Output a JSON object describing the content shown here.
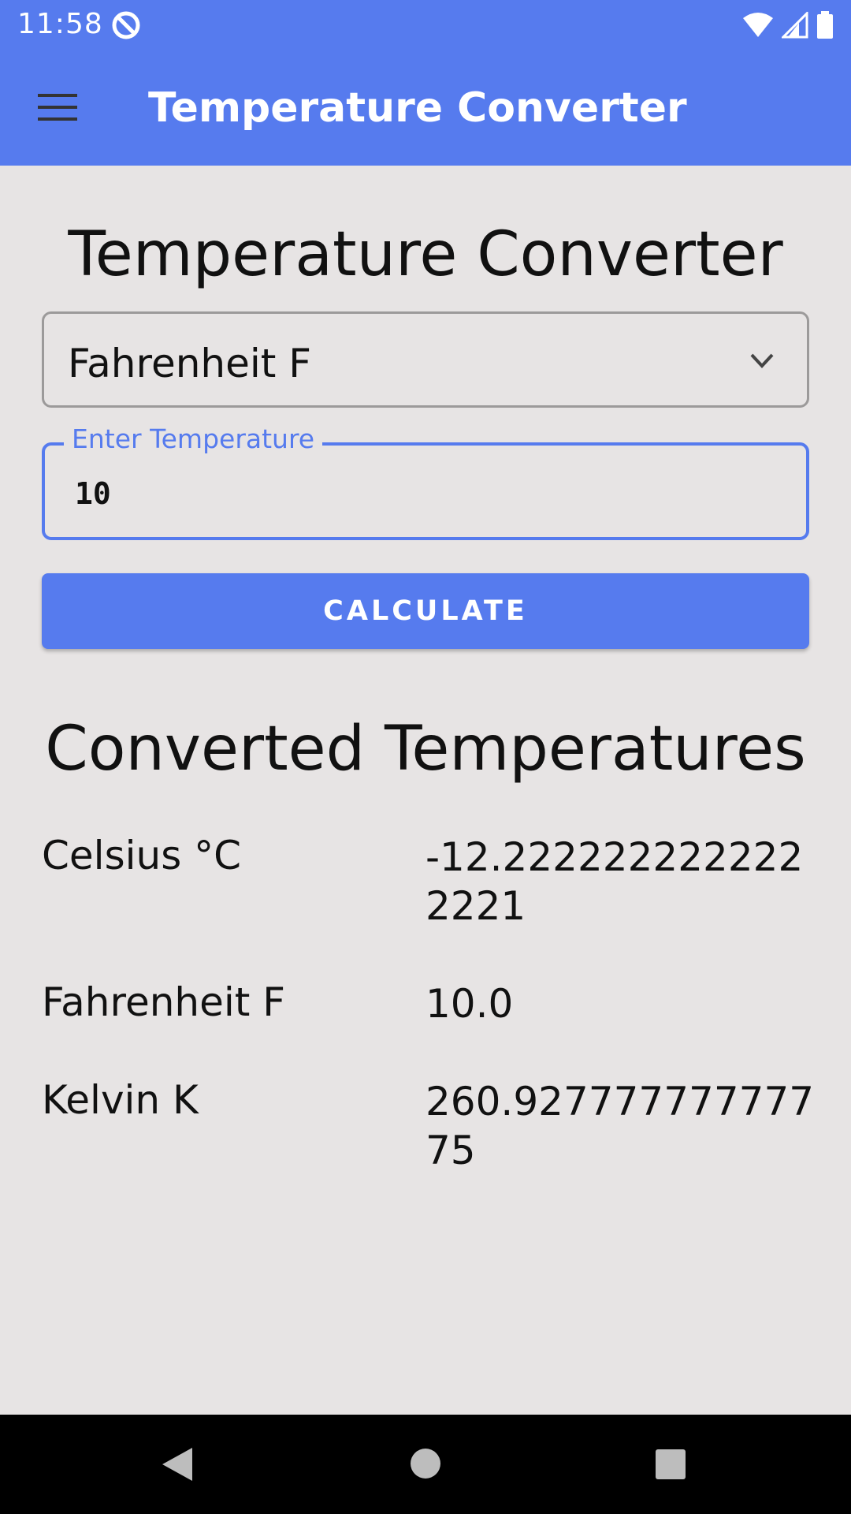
{
  "status_bar": {
    "time": "11:58",
    "icons": [
      "app-notification-icon",
      "wifi-icon",
      "cell-signal-icon",
      "battery-icon"
    ]
  },
  "app_bar": {
    "title": "Temperature Converter",
    "menu_icon": "hamburger-menu-icon"
  },
  "main": {
    "heading": "Temperature Converter",
    "unit_select": {
      "selected": "Fahrenheit F",
      "icon": "chevron-down-icon"
    },
    "temperature_field": {
      "label": "Enter Temperature",
      "value": "10"
    },
    "calculate_button": "CALCULATE",
    "results_heading": "Converted Temperatures",
    "results": [
      {
        "label": "Celsius °C",
        "value": "-12.2222222222222221"
      },
      {
        "label": "Fahrenheit F",
        "value": "10.0"
      },
      {
        "label": "Kelvin K",
        "value": "260.92777777777775"
      }
    ]
  },
  "nav_bar": {
    "icons": [
      "back-icon",
      "home-icon",
      "recents-icon"
    ]
  },
  "colors": {
    "accent": "#567bee",
    "background": "#e7e4e4",
    "text": "#111111",
    "nav_bar": "#000000"
  }
}
